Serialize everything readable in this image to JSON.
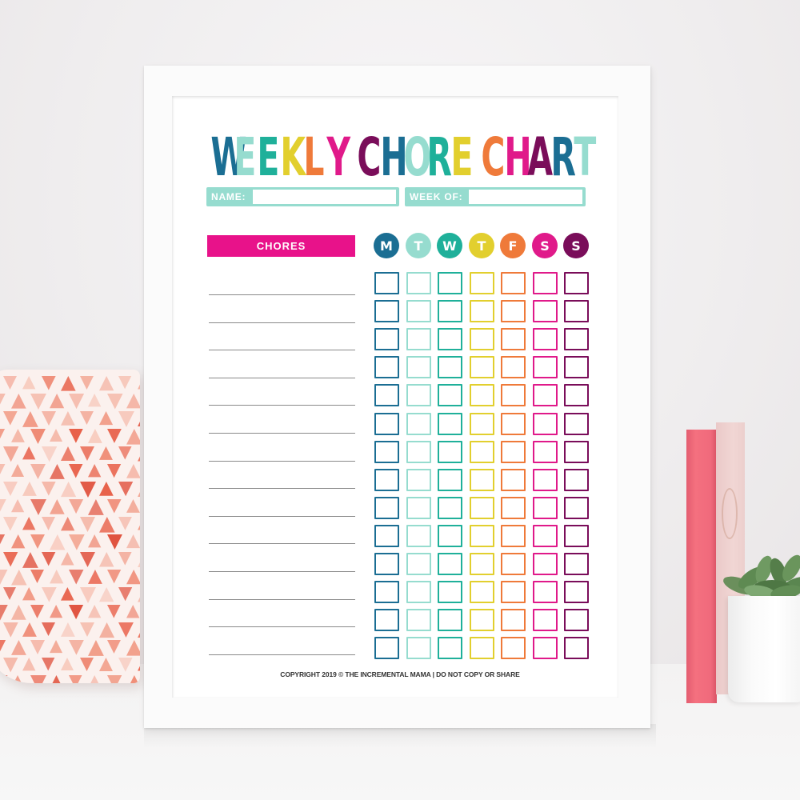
{
  "scene": {
    "description": "Photo of a framed printable chore chart on a white table with a patterned pillow, a pink book and a succulent"
  },
  "colors": {
    "blue": "#1b6e93",
    "mint": "#96dccf",
    "teal": "#1fb09a",
    "yellow": "#e2cf2e",
    "orange": "#ef7a3a",
    "magenta": "#e01a8a",
    "plum": "#7a0d5a",
    "chores_header_bg": "#e8128a",
    "field_bg": "#96dccf",
    "line": "#8a8a8a"
  },
  "document": {
    "title_letters": [
      {
        "char": "W",
        "color": "blue"
      },
      {
        "char": "E",
        "color": "mint"
      },
      {
        "char": "E",
        "color": "teal"
      },
      {
        "char": "K",
        "color": "yellow"
      },
      {
        "char": "L",
        "color": "orange"
      },
      {
        "char": "Y",
        "color": "magenta"
      },
      {
        "char": " ",
        "color": ""
      },
      {
        "char": "C",
        "color": "plum"
      },
      {
        "char": "H",
        "color": "blue"
      },
      {
        "char": "O",
        "color": "mint"
      },
      {
        "char": "R",
        "color": "teal"
      },
      {
        "char": "E",
        "color": "yellow"
      },
      {
        "char": " ",
        "color": ""
      },
      {
        "char": "C",
        "color": "orange"
      },
      {
        "char": "H",
        "color": "magenta"
      },
      {
        "char": "A",
        "color": "plum"
      },
      {
        "char": "R",
        "color": "blue"
      },
      {
        "char": "T",
        "color": "mint"
      }
    ],
    "title": "WEEKLY CHORE CHART",
    "fields": {
      "name_label": "NAME:",
      "name_value": "",
      "week_label": "WEEK OF:",
      "week_value": ""
    },
    "chores_header": "CHORES",
    "days": [
      {
        "label": "M",
        "color": "blue"
      },
      {
        "label": "T",
        "color": "mint"
      },
      {
        "label": "W",
        "color": "teal"
      },
      {
        "label": "T",
        "color": "yellow"
      },
      {
        "label": "F",
        "color": "orange"
      },
      {
        "label": "S",
        "color": "magenta"
      },
      {
        "label": "S",
        "color": "plum"
      }
    ],
    "row_count": 14,
    "chores": [
      "",
      "",
      "",
      "",
      "",
      "",
      "",
      "",
      "",
      "",
      "",
      "",
      "",
      ""
    ],
    "checked": [],
    "copyright": "COPYRIGHT 2019 © THE INCREMENTAL MAMA | DO NOT COPY OR SHARE"
  }
}
